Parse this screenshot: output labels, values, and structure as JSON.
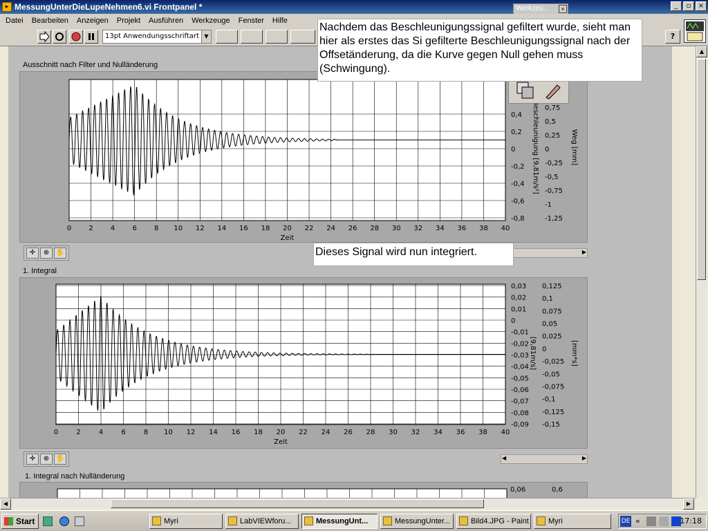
{
  "window": {
    "title": "MessungUnterDieLupeNehmen6.vi Frontpanel *",
    "app_icon": "labview-vi-icon"
  },
  "window_buttons": {
    "minimize": "_",
    "maximize": "▫",
    "close": "×"
  },
  "menu": [
    "Datei",
    "Bearbeiten",
    "Anzeigen",
    "Projekt",
    "Ausführen",
    "Werkzeuge",
    "Fenster",
    "Hilfe"
  ],
  "toolbar": {
    "font": "13pt Anwendungsschriftart",
    "help": "?"
  },
  "floating_palette": {
    "title": "Werkzeu...",
    "close": "×"
  },
  "notes": {
    "note1": "Nachdem das Beschleunigungssignal gefiltert wurde, sieht man hier als erstes das Si gefilterte Beschleunigungssignal nach der Offsetänderung, da die Kurve gegen Null gehen muss (Schwingung).",
    "note2": "Dieses Signal wird nun integriert."
  },
  "charts": {
    "chart1_label": "Ausschnitt nach Filter und Nulländerung",
    "chart2_label": "1. Integral",
    "chart3_label": "1. Integral nach Nulländerung"
  },
  "chart_data": [
    {
      "type": "line",
      "title": "Ausschnitt nach Filter und Nulländerung",
      "xlabel": "Zeit",
      "ylabel": "Beschleunigung [9,81m/s²]",
      "ylabel2": "Weg [mm]",
      "xlim": [
        0,
        40
      ],
      "ylim": [
        -0.8,
        0.6
      ],
      "y2lim": [
        -1.25,
        1.0
      ],
      "xticks": [
        "0",
        "2",
        "4",
        "6",
        "8",
        "10",
        "12",
        "14",
        "16",
        "18",
        "20",
        "22",
        "24",
        "26",
        "28",
        "30",
        "32",
        "34",
        "36",
        "38",
        "40"
      ],
      "yticks": [
        "0,4",
        "0,2",
        "0",
        "-0,2",
        "-0,4",
        "-0,6",
        "-0,8"
      ],
      "y2ticks": [
        "0,75",
        "0,5",
        "0,25",
        "0",
        "-0,25",
        "-0,5",
        "-0,75",
        "-1",
        "-1,25"
      ],
      "grid": true,
      "series": [
        {
          "amplitude_max": 0.55,
          "peak_time": 6,
          "decay_end": 24.5,
          "period": 0.55
        }
      ]
    },
    {
      "type": "line",
      "title": "1. Integral",
      "xlabel": "Zeit",
      "ylabel": "[9,81m/s]",
      "ylabel2": "[mm*s]",
      "xlim": [
        0,
        40
      ],
      "ylim": [
        -0.09,
        0.03
      ],
      "y2lim": [
        -0.15,
        0.125
      ],
      "xticks": [
        "0",
        "2",
        "4",
        "6",
        "8",
        "10",
        "12",
        "14",
        "16",
        "18",
        "20",
        "22",
        "24",
        "26",
        "28",
        "30",
        "32",
        "34",
        "36",
        "38",
        "40"
      ],
      "yticks": [
        "0,03",
        "0,02",
        "0,01",
        "0",
        "-0,01",
        "-0,02",
        "-0,03",
        "-0,04",
        "-0,05",
        "-0,06",
        "-0,07",
        "-0,08",
        "-0,09"
      ],
      "y2ticks": [
        "0,125",
        "0,1",
        "0,075",
        "0,05",
        "0,025",
        "0",
        "-0,025",
        "-0,05",
        "-0,075",
        "-0,1",
        "-0,125",
        "-0,15"
      ],
      "grid": true,
      "series": [
        {
          "center": -0.03,
          "amplitude_max": 0.05,
          "peak_time": 4,
          "decay_end": 28,
          "period": 0.55
        }
      ]
    },
    {
      "type": "line",
      "title": "1. Integral nach Nulländerung",
      "yticks": [
        "0,06"
      ],
      "y2ticks": [
        "0,6"
      ]
    }
  ],
  "taskbar": {
    "start": "Start",
    "tasks": [
      "Myri",
      "LabVIEWforu...",
      "MessungUnt...",
      "MessungUnter...",
      "Bild4.JPG - Paint",
      "Myri"
    ],
    "lang": "DE",
    "clock": "17:18"
  }
}
